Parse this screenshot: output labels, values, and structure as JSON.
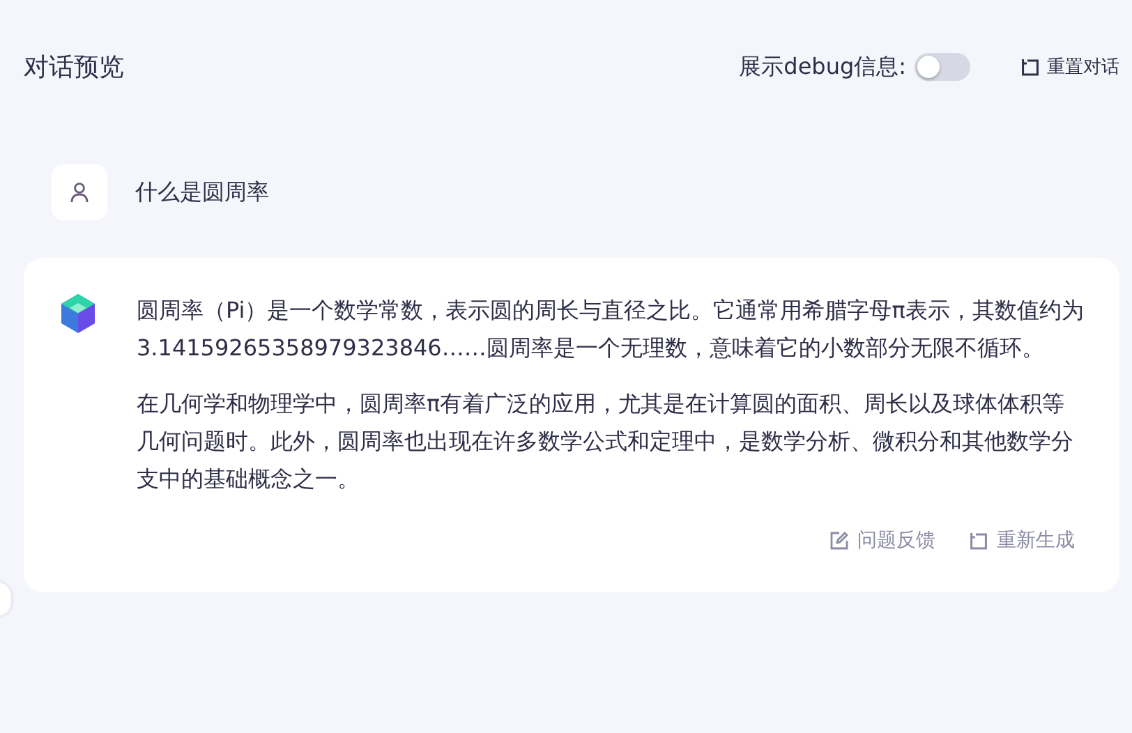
{
  "header": {
    "title": "对话预览",
    "debug_label": "展示debug信息:",
    "debug_on": false,
    "reset_button": "重置对话"
  },
  "messages": [
    {
      "kind": "user",
      "paragraphs": [
        "什么是圆周率"
      ]
    },
    {
      "kind": "bot",
      "paragraphs": [
        "圆周率（Pi）是一个数学常数，表示圆的周长与直径之比。它通常用希腊字母π表示，其数值约为3.14159265358979323846……圆周率是一个无理数，意味着它的小数部分无限不循环。",
        "在几何学和物理学中，圆周率π有着广泛的应用，尤其是在计算圆的面积、周长以及球体体积等几何问题时。此外，圆周率也出现在许多数学公式和定理中，是数学分析、微积分和其他数学分支中的基础概念之一。"
      ],
      "actions": [
        {
          "kind": "feedback",
          "label": "问题反馈"
        },
        {
          "kind": "regenerate",
          "label": "重新生成"
        }
      ]
    }
  ]
}
